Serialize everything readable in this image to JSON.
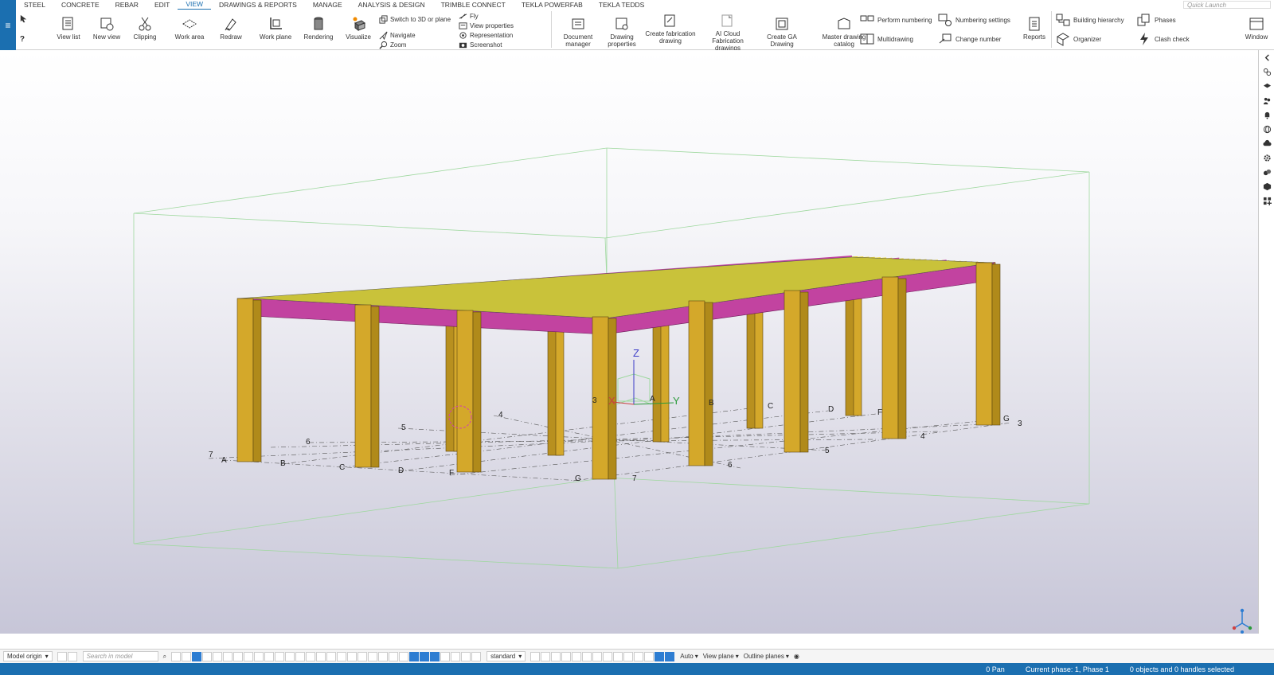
{
  "menu": {
    "icon": "hamburger-icon",
    "glyph": "≡"
  },
  "tabs": [
    {
      "label": "STEEL",
      "active": false
    },
    {
      "label": "CONCRETE",
      "active": false
    },
    {
      "label": "REBAR",
      "active": false
    },
    {
      "label": "EDIT",
      "active": false
    },
    {
      "label": "VIEW",
      "active": true
    },
    {
      "label": "DRAWINGS & REPORTS",
      "active": false
    },
    {
      "label": "MANAGE",
      "active": false
    },
    {
      "label": "ANALYSIS & DESIGN",
      "active": false
    },
    {
      "label": "TRIMBLE CONNECT",
      "active": false
    },
    {
      "label": "TEKLA POWERFAB",
      "active": false
    },
    {
      "label": "TEKLA TEDDS",
      "active": false
    }
  ],
  "quick_launch": {
    "placeholder": "Quick Launch"
  },
  "ribbon": {
    "view_list": "View list",
    "new_view": "New view",
    "clipping": "Clipping",
    "work_area": "Work area",
    "redraw": "Redraw",
    "work_plane": "Work plane",
    "rendering": "Rendering",
    "visualize": "Visualize",
    "switch_3d": "Switch to 3D or plane",
    "navigate": "Navigate",
    "zoom": "Zoom",
    "fly": "Fly",
    "view_properties": "View properties",
    "representation": "Representation",
    "screenshot": "Screenshot",
    "document_manager": "Document manager",
    "drawing_properties": "Drawing properties",
    "create_fabrication": "Create fabrication drawing",
    "ai_cloud": "AI Cloud Fabrication drawings",
    "create_ga": "Create GA Drawing",
    "master_catalog": "Master drawing catalog",
    "perform_numbering": "Perform numbering",
    "multidrawing": "Multidrawing",
    "numbering_settings": "Numbering settings",
    "change_number": "Change number",
    "reports": "Reports",
    "building_hierarchy": "Building hierarchy",
    "organizer": "Organizer",
    "phases": "Phases",
    "clash_check": "Clash check",
    "window": "Window"
  },
  "viewport": {
    "grid_labels_front_letters": [
      "A",
      "B",
      "C",
      "D",
      "F",
      "G"
    ],
    "grid_labels_front_numbers": [
      "7",
      "6",
      "5",
      "4",
      "3"
    ],
    "grid_labels_back_letters": [
      "A",
      "B",
      "C",
      "D",
      "F",
      "G"
    ],
    "grid_labels_back_numbers": [
      "7",
      "6",
      "5",
      "4",
      "3"
    ],
    "axis_z": "Z",
    "axis_x": "X",
    "axis_y": "Y",
    "colors": {
      "column": "#d4a82a",
      "beam_magenta": "#c243a0",
      "joist_yellow": "#e8d23a",
      "work_area": "#9ed89e"
    }
  },
  "bottom": {
    "model_origin": "Model origin",
    "search_placeholder": "Search in model",
    "standard": "standard",
    "auto": "Auto",
    "view_plane": "View plane",
    "outline_planes": "Outline planes"
  },
  "status": {
    "pan": "0 Pan",
    "phase": "Current phase: 1, Phase 1",
    "selection": "0 objects and 0 handles selected"
  }
}
